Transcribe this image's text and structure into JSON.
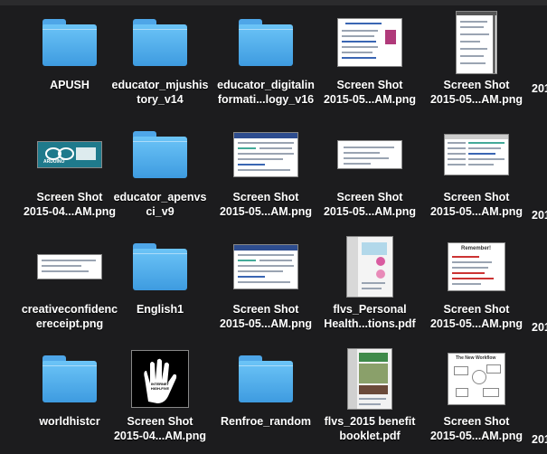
{
  "window": {
    "view": "icon-grid"
  },
  "items": [
    {
      "name": "APUSH",
      "kind": "folder"
    },
    {
      "name": "educator_mjushis\ntory_v14",
      "kind": "folder"
    },
    {
      "name": "educator_digitalin\nformati...logy_v16",
      "kind": "folder"
    },
    {
      "name": "Screen Shot\n2015-05...AM.png",
      "kind": "screenshot-doc"
    },
    {
      "name": "Screen Shot\n2015-05...AM.png",
      "kind": "screenshot-tall"
    },
    {
      "name": "Screen Shot\n2015-04...AM.png",
      "kind": "arduino-banner"
    },
    {
      "name": "educator_apenvs\nci_v9",
      "kind": "folder"
    },
    {
      "name": "Screen Shot\n2015-05...AM.png",
      "kind": "screenshot-form"
    },
    {
      "name": "Screen Shot\n2015-05...AM.png",
      "kind": "screenshot-wide"
    },
    {
      "name": "Screen Shot\n2015-05...AM.png",
      "kind": "screenshot-table"
    },
    {
      "name": "creativeconfidenc\nereceipt.png",
      "kind": "receipt"
    },
    {
      "name": "English1",
      "kind": "folder"
    },
    {
      "name": "Screen Shot\n2015-05...AM.png",
      "kind": "screenshot-form"
    },
    {
      "name": "flvs_Personal\nHealth...tions.pdf",
      "kind": "pdf-health"
    },
    {
      "name": "Screen Shot\n2015-05...AM.png",
      "kind": "remember-doc"
    },
    {
      "name": "worldhistcr",
      "kind": "folder"
    },
    {
      "name": "Screen Shot\n2015-04...AM.png",
      "kind": "hand-poster"
    },
    {
      "name": "Renfroe_random",
      "kind": "folder"
    },
    {
      "name": "flvs_2015 benefit\nbooklet.pdf",
      "kind": "pdf-benefit"
    },
    {
      "name": "Screen Shot\n2015-05...AM.png",
      "kind": "workflow-doc"
    }
  ],
  "partial_column": {
    "labels": [
      "201",
      "201",
      "201",
      "201"
    ]
  },
  "thumb_text": {
    "arduino": "ARDUINO",
    "remember": "Remember!",
    "workflow": "The New Workflow",
    "hand": "INTERNET HIGH-FIVE PLACE HAND HERE"
  },
  "colors": {
    "background": "#1c1c1e",
    "folder": "#57b2ef",
    "label": "#ffffff"
  }
}
